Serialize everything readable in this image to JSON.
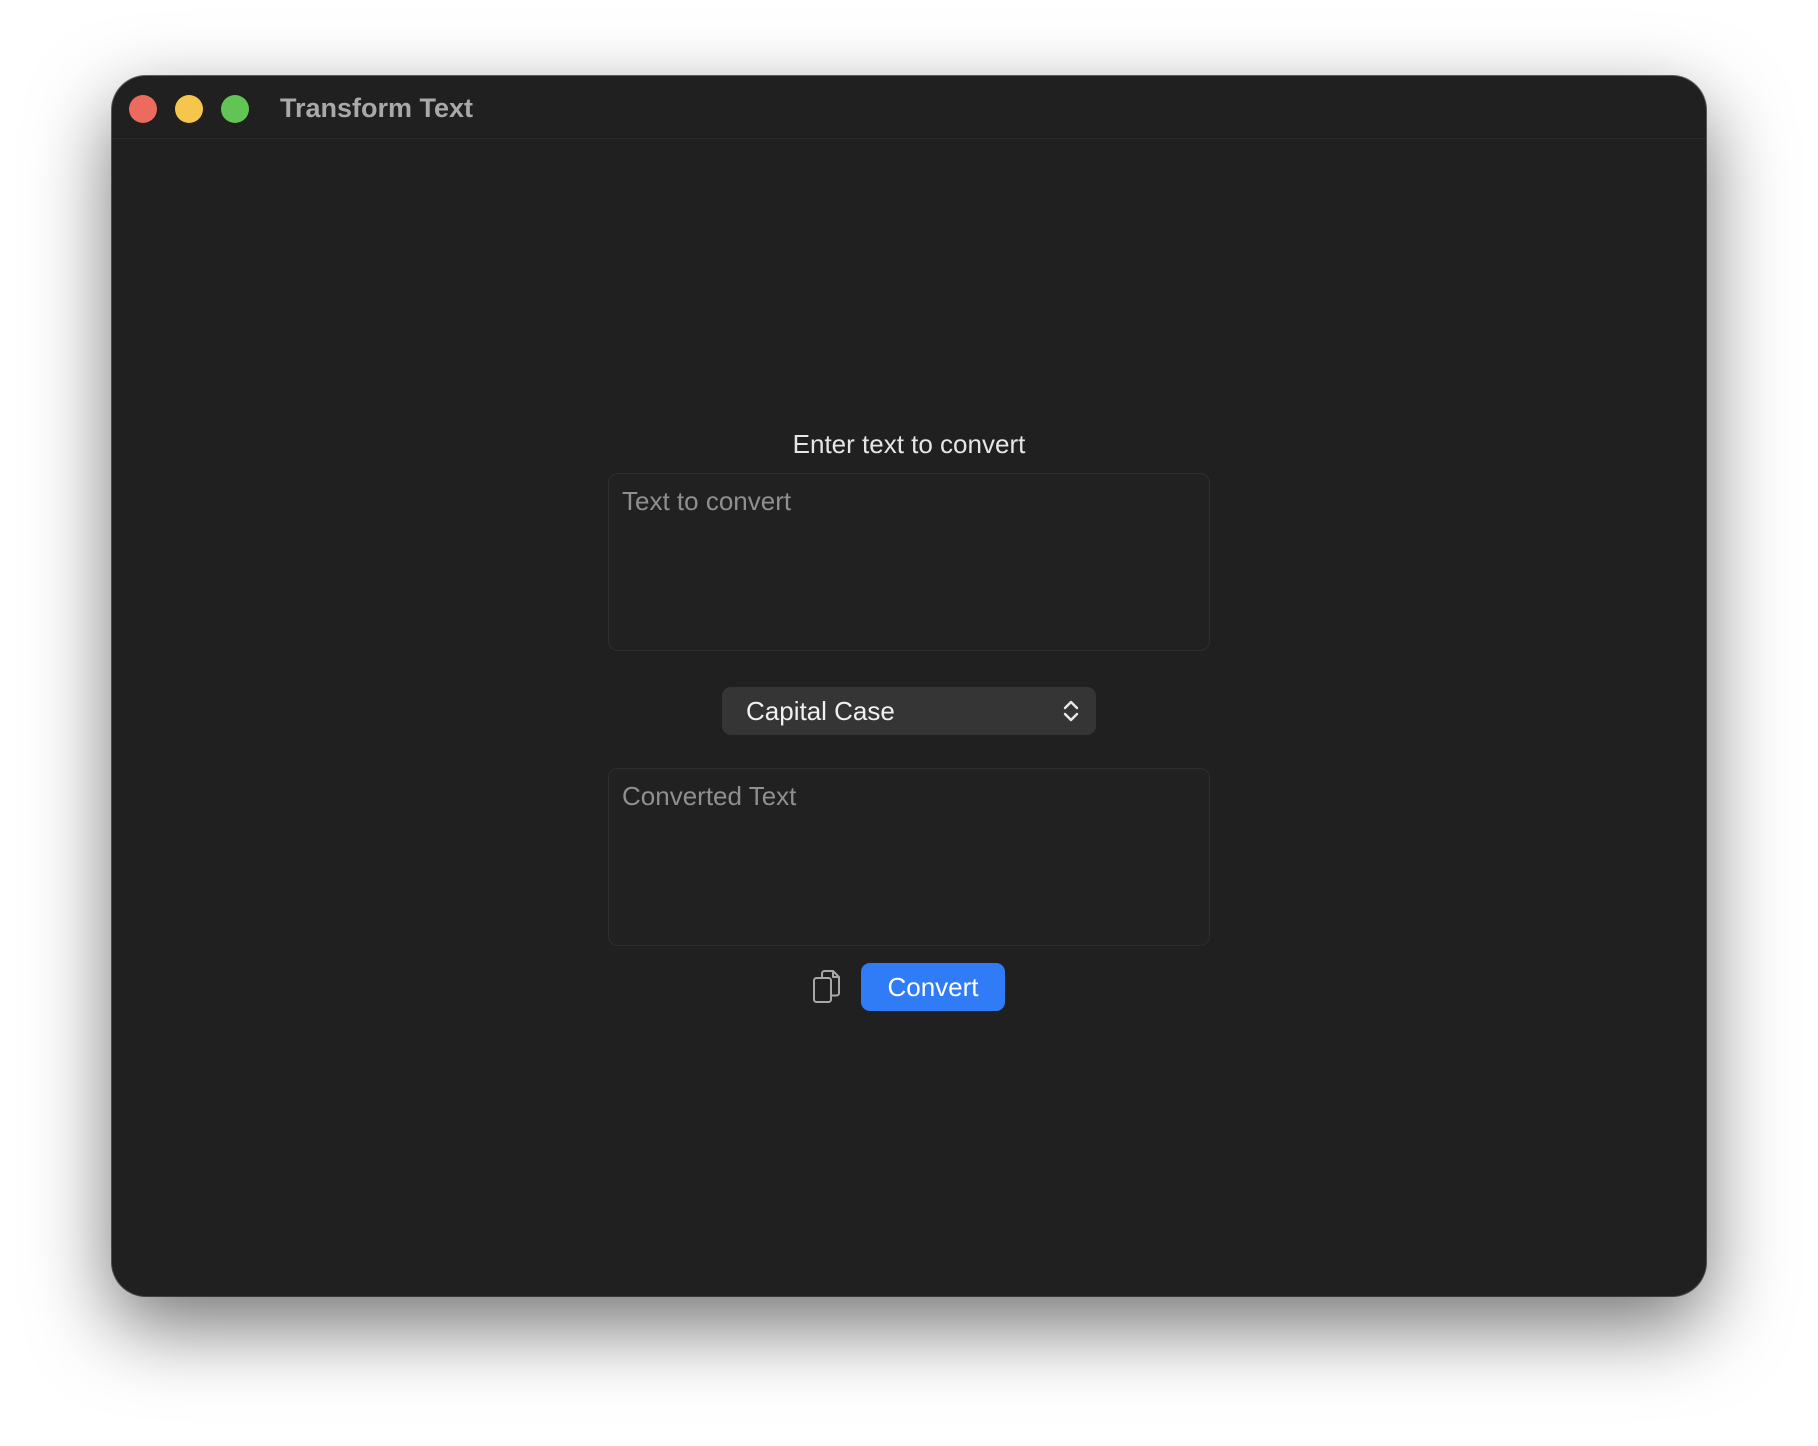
{
  "window": {
    "title": "Transform Text"
  },
  "form": {
    "prompt": "Enter text to convert",
    "input_placeholder": "Text to convert",
    "case_select": {
      "selected": "Capital Case"
    },
    "output_placeholder": "Converted Text",
    "convert_label": "Convert"
  },
  "icons": {
    "copy": "copy-icon",
    "select_chevron": "chevron-up-down-icon"
  },
  "colors": {
    "accent": "#2f7cf6",
    "window_bg": "#202020",
    "close": "#ed6a5e",
    "minimize": "#f5c54c",
    "zoom": "#61c454"
  }
}
